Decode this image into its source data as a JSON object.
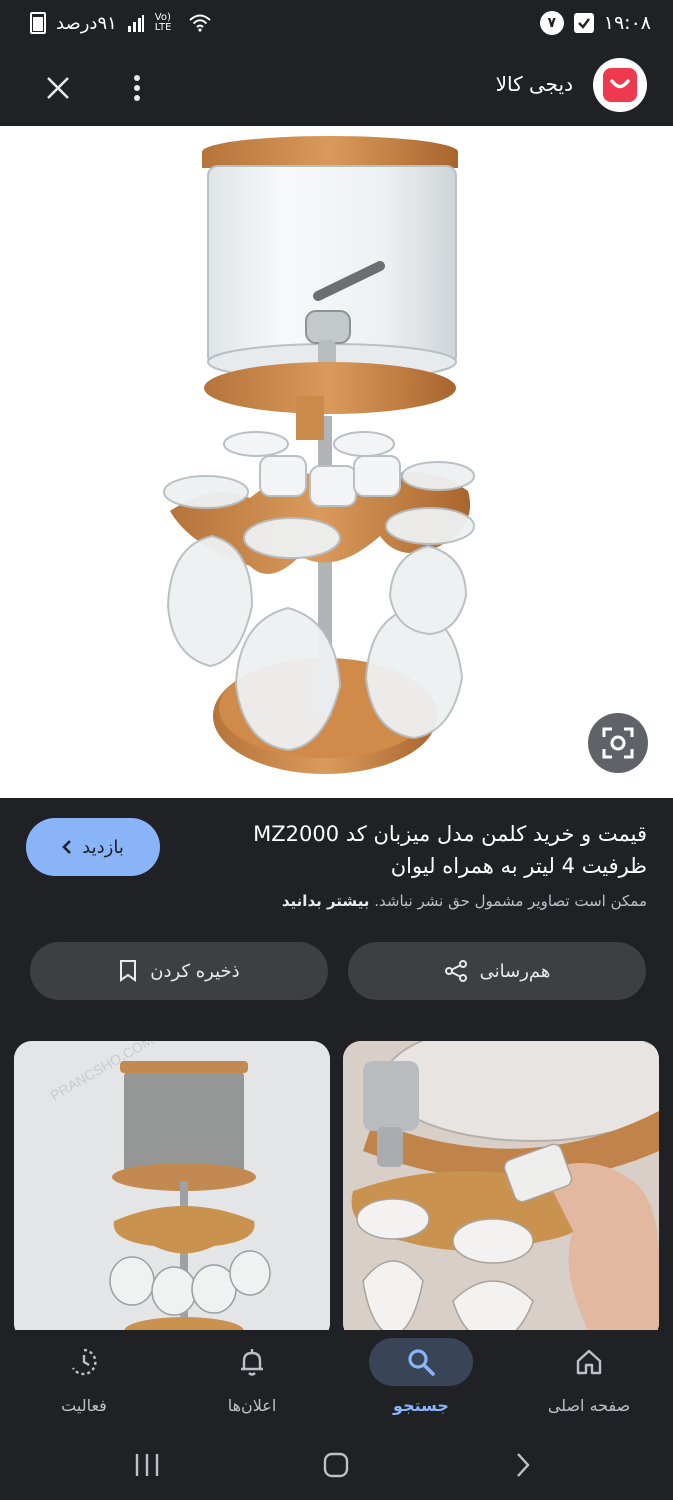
{
  "status_bar": {
    "battery_text": "۹۱درصد",
    "network_text": "Vo) LTE",
    "time": "۱۹:۰۸",
    "notification_count": "۷"
  },
  "top_bar": {
    "site_name": "دیجی کالا",
    "close_icon": "close-icon",
    "more_icon": "more-vert-icon"
  },
  "result": {
    "title": "قیمت و خرید کلمن مدل میزبان کد MZ2000 ظرفیت 4 لیتر به همراه لیوان",
    "visit_label": "بازدید",
    "copyright_note": "ممکن است تصاویر مشمول حق نشر نباشد.",
    "learn_more": "بیشتر بدانید"
  },
  "actions": {
    "share_label": "هم‌رسانی",
    "save_label": "ذخیره کردن"
  },
  "thumbnails": {
    "watermark": "PRANCSHO.COM"
  },
  "bottom_nav": {
    "items": [
      {
        "label": "صفحه اصلی",
        "icon": "home-icon"
      },
      {
        "label": "جستجو",
        "icon": "search-icon",
        "active": true
      },
      {
        "label": "اعلان‌ها",
        "icon": "bell-icon"
      },
      {
        "label": "فعالیت",
        "icon": "activity-icon"
      }
    ]
  },
  "colors": {
    "background": "#202124",
    "accent": "#8ab4f8",
    "brand": "#ef394e"
  }
}
